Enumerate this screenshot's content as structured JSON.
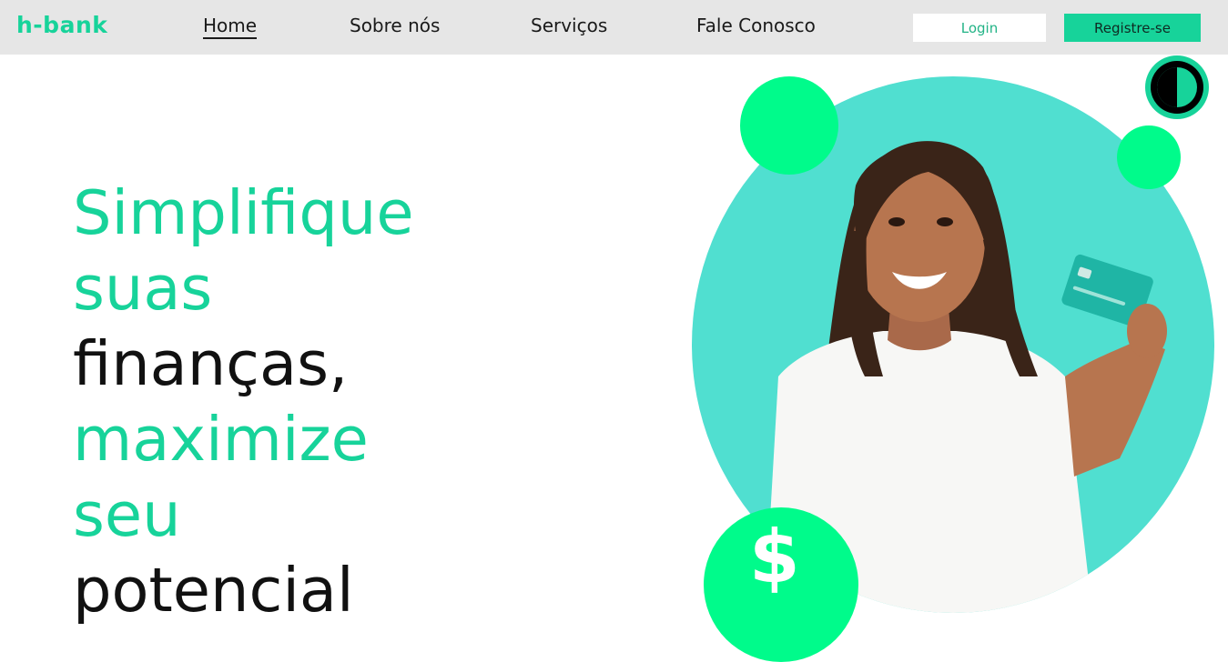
{
  "brand": {
    "logo_text": "h-bank",
    "accent": "#17d39a",
    "bright_green": "#00fb8b",
    "teal": "#50dfd0"
  },
  "nav": {
    "links": [
      {
        "label": "Home",
        "active": true
      },
      {
        "label": "Sobre nós",
        "active": false
      },
      {
        "label": "Serviços",
        "active": false
      },
      {
        "label": "Fale Conosco",
        "active": false
      }
    ],
    "login_label": "Login",
    "register_label": "Registre-se"
  },
  "hero": {
    "lines": [
      "Simplifique",
      "suas",
      "finanças,",
      "maximize",
      "seu",
      "potencial"
    ]
  },
  "badge": {
    "symbol": "$"
  },
  "icons": {
    "theme_toggle": "contrast-icon",
    "dollar": "dollar-icon"
  }
}
